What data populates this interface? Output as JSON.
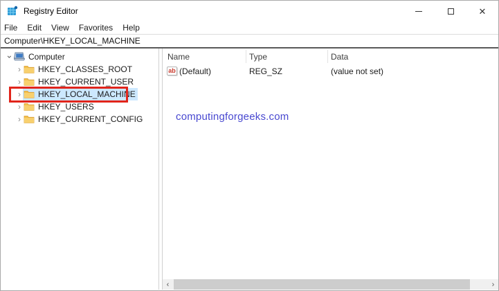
{
  "window": {
    "title": "Registry Editor",
    "controls": {
      "minimize": "minimize",
      "maximize": "maximize",
      "close": "✕"
    }
  },
  "menu": {
    "items": [
      "File",
      "Edit",
      "View",
      "Favorites",
      "Help"
    ]
  },
  "address_bar": {
    "value": "Computer\\HKEY_LOCAL_MACHINE"
  },
  "tree": {
    "root": {
      "label": "Computer",
      "expanded": true
    },
    "items": [
      {
        "label": "HKEY_CLASSES_ROOT",
        "selected": false
      },
      {
        "label": "HKEY_CURRENT_USER",
        "selected": false
      },
      {
        "label": "HKEY_LOCAL_MACHINE",
        "selected": true,
        "annotated": "red-box"
      },
      {
        "label": "HKEY_USERS",
        "selected": false
      },
      {
        "label": "HKEY_CURRENT_CONFIG",
        "selected": false
      }
    ],
    "chevron_collapsed": "›",
    "chevron_expanded": "›"
  },
  "list": {
    "columns": [
      "Name",
      "Type",
      "Data"
    ],
    "rows": [
      {
        "name": "(Default)",
        "type": "REG_SZ",
        "data": "(value not set)",
        "icon": "string-value-icon",
        "icon_glyph": "ab"
      }
    ]
  },
  "watermark": {
    "text": "computingforgeeks.com",
    "color": "#4848d0"
  },
  "scrollbar": {
    "left_arrow": "‹",
    "right_arrow": "›"
  },
  "colors": {
    "selection": "#cce8ff",
    "annotation_red": "#e1251b",
    "address_divider": "#595959",
    "folder": "#f3c04a",
    "scroll_thumb": "#cdcdcd",
    "scroll_track": "#f0f0f0"
  }
}
